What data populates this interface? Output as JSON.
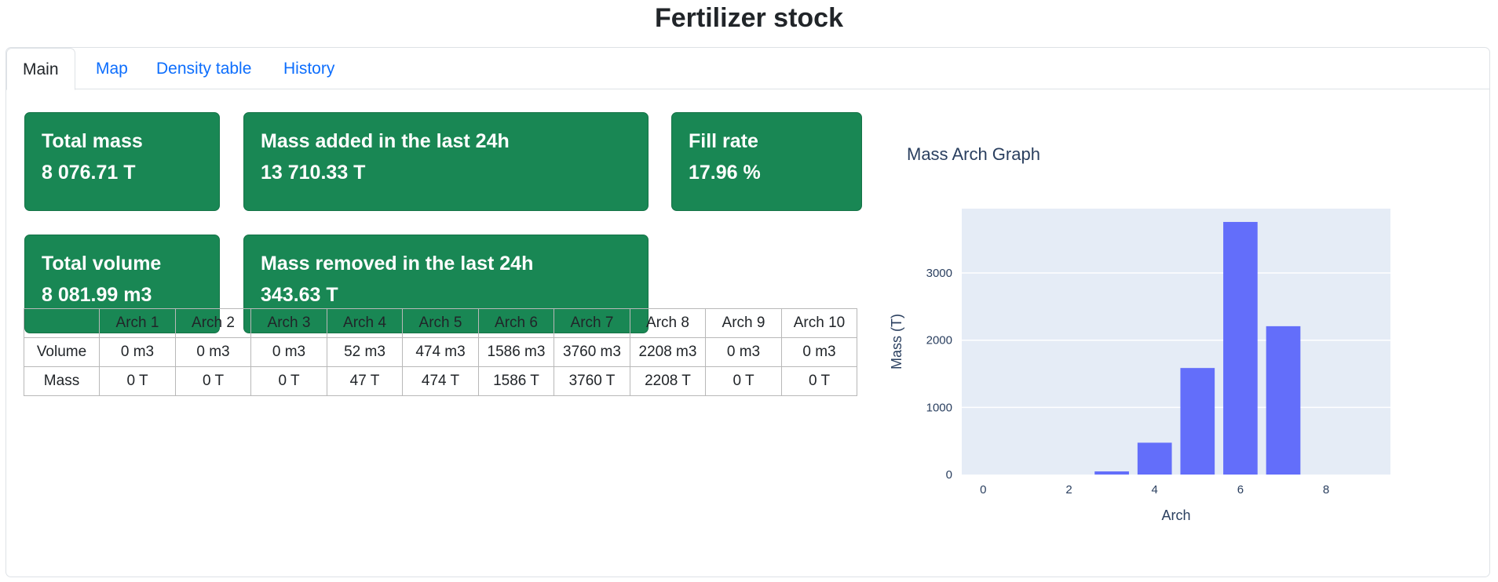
{
  "page_title": "Fertilizer stock",
  "tabs": [
    {
      "label": "Main",
      "active": true
    },
    {
      "label": "Map",
      "active": false
    },
    {
      "label": "Density table",
      "active": false
    },
    {
      "label": "History",
      "active": false
    }
  ],
  "cards": {
    "total_mass": {
      "title": "Total mass",
      "value": "8 076.71 T"
    },
    "mass_added": {
      "title": "Mass added in the last 24h",
      "value": "13 710.33 T"
    },
    "fill_rate": {
      "title": "Fill rate",
      "value": "17.96 %"
    },
    "total_volume": {
      "title": "Total volume",
      "value": "8 081.99 m3"
    },
    "mass_removed": {
      "title": "Mass removed in the last 24h",
      "value": "343.63 T"
    }
  },
  "colors": {
    "card_bg": "#198754",
    "bar": "#636efa",
    "plot_bg": "#e5ecf6"
  },
  "table": {
    "headers": [
      "",
      "Arch 1",
      "Arch 2",
      "Arch 3",
      "Arch 4",
      "Arch 5",
      "Arch 6",
      "Arch 7",
      "Arch 8",
      "Arch 9",
      "Arch 10"
    ],
    "rows": [
      {
        "label": "Volume",
        "cells": [
          "0 m3",
          "0 m3",
          "0 m3",
          "52 m3",
          "474 m3",
          "1586 m3",
          "3760 m3",
          "2208 m3",
          "0 m3",
          "0 m3"
        ]
      },
      {
        "label": "Mass",
        "cells": [
          "0 T",
          "0 T",
          "0 T",
          "47 T",
          "474 T",
          "1586 T",
          "3760 T",
          "2208 T",
          "0 T",
          "0 T"
        ]
      }
    ]
  },
  "chart_data": {
    "type": "bar",
    "title": "Mass Arch Graph",
    "xlabel": "Arch",
    "ylabel": "Mass (T)",
    "x": [
      0,
      1,
      2,
      3,
      4,
      5,
      6,
      7,
      8,
      9
    ],
    "values": [
      0,
      0,
      0,
      47,
      474,
      1586,
      3760,
      2208,
      0,
      0
    ],
    "xlim": [
      -0.5,
      9.5
    ],
    "ylim": [
      0,
      3958
    ],
    "xticks": [
      0,
      2,
      4,
      6,
      8
    ],
    "yticks": [
      0,
      1000,
      2000,
      3000
    ],
    "grid": true
  }
}
